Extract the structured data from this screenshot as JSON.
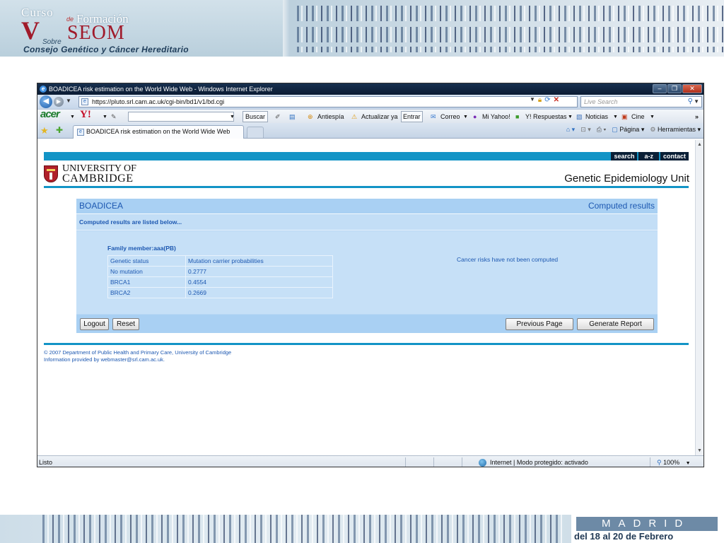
{
  "banner": {
    "curso": "Curso",
    "de": "de",
    "formacion": "Formación",
    "roman": "V",
    "seom": "SEOM",
    "sobre": "Sobre",
    "consejo": "Consejo Genético y Cáncer Hereditario",
    "madrid": "MADRID",
    "fechas": "del 18 al 20 de Febrero"
  },
  "browser": {
    "window_title": "BOADICEA risk estimation on the World Wide Web - Windows Internet Explorer",
    "url": "https://pluto.srl.cam.ac.uk/cgi-bin/bd1/v1/bd.cgi",
    "search_placeholder": "Live Search",
    "toolbar": {
      "acer": "acer",
      "yahoo": "Y!",
      "buscar": "Buscar",
      "antiespia": "Antiespía",
      "actualizar": "Actualizar ya",
      "entrar": "Entrar",
      "correo": "Correo",
      "mi_yahoo": "Mi Yahoo!",
      "respuestas": "Y! Respuestas",
      "noticias": "Noticias",
      "cine": "Cine",
      "more": "»"
    },
    "tab_title": "BOADICEA risk estimation on the World Wide Web",
    "command_bar": {
      "pagina": "Página",
      "herramientas": "Herramientas"
    },
    "status": {
      "left": "Listo",
      "zone": "Internet | Modo protegido: activado",
      "zoom": "100%"
    }
  },
  "site": {
    "top_links": [
      "search",
      "a-z",
      "contact"
    ],
    "uni_line1": "UNIVERSITY OF",
    "uni_line2": "CAMBRIDGE",
    "unit_title": "Genetic Epidemiology Unit",
    "panel_title": "BOADICEA",
    "panel_status": "Computed results",
    "sub_heading": "Computed results are listed below...",
    "family_member": "Family member:aaa(PB)",
    "table": {
      "headers": [
        "Genetic status",
        "Mutation carrier probabilities"
      ],
      "rows": [
        [
          "No mutation",
          "0.2777"
        ],
        [
          "BRCA1",
          "0.4554"
        ],
        [
          "BRCA2",
          "0.2669"
        ]
      ]
    },
    "cancer_note": "Cancer risks have not been computed",
    "buttons": {
      "logout": "Logout",
      "reset": "Reset",
      "previous": "Previous Page",
      "generate": "Generate Report"
    },
    "copyright": "© 2007 Department of Public Health and Primary Care, University of Cambridge",
    "contact": "Information provided by webmaster@srl.cam.ac.uk."
  }
}
